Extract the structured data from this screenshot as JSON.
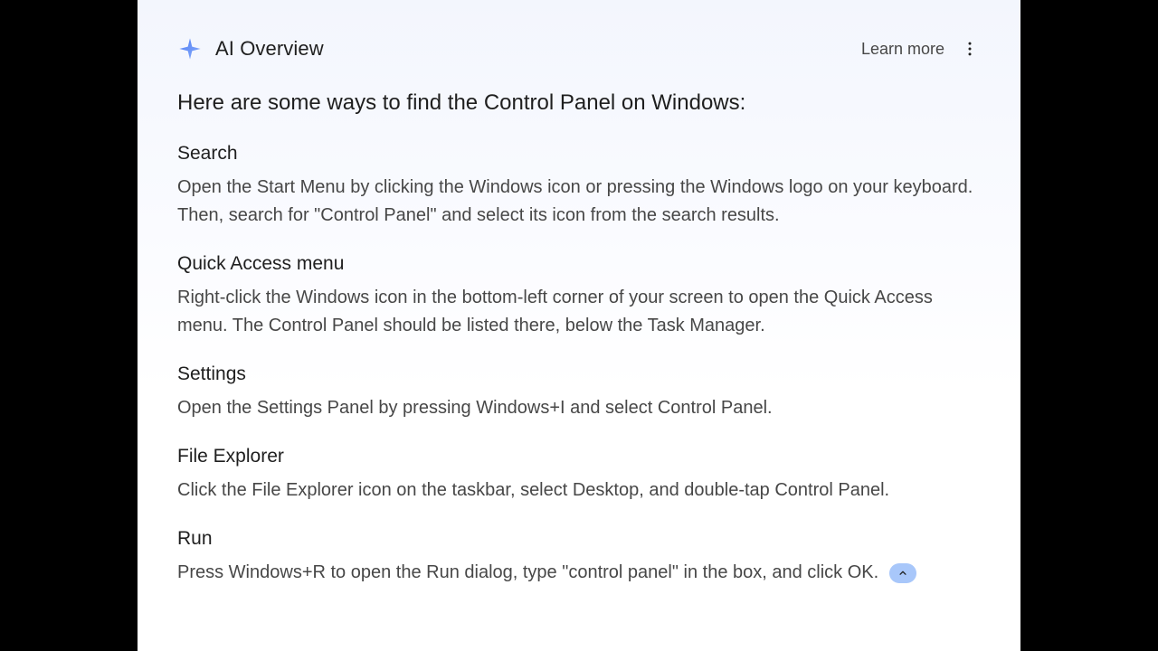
{
  "header": {
    "title": "AI Overview",
    "learn_more": "Learn more"
  },
  "intro": "Here are some ways to find the Control Panel on Windows:",
  "methods": [
    {
      "title": "Search",
      "body": "Open the Start Menu by clicking the Windows icon or pressing the Windows logo on your keyboard. Then, search for \"Control Panel\" and select its icon from the search results."
    },
    {
      "title": "Quick Access menu",
      "body": "Right-click the Windows icon in the bottom-left corner of your screen to open the Quick Access menu. The Control Panel should be listed there, below the Task Manager."
    },
    {
      "title": "Settings",
      "body": "Open the Settings Panel by pressing Windows+I and select Control Panel."
    },
    {
      "title": "File Explorer",
      "body": "Click the File Explorer icon on the taskbar, select Desktop, and double-tap Control Panel."
    },
    {
      "title": "Run",
      "body": "Press Windows+R to open the Run dialog, type \"control panel\" in the box, and click OK."
    }
  ]
}
